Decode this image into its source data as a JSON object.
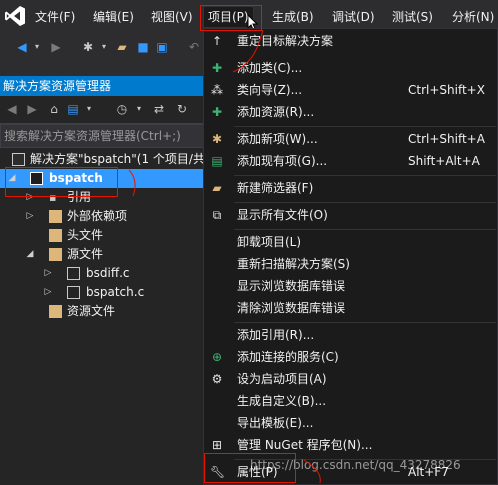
{
  "menubar": {
    "items": [
      "文件(F)",
      "编辑(E)",
      "视图(V)",
      "项目(P)",
      "生成(B)",
      "调试(D)",
      "测试(S)",
      "分析(N)"
    ]
  },
  "toolbar": {
    "icons": [
      "back-icon",
      "forward-icon",
      "new-project-icon",
      "open-icon",
      "save-icon",
      "save-all-icon",
      "undo-icon"
    ]
  },
  "solution_explorer": {
    "title": "解决方案资源管理器",
    "search_placeholder": "搜索解决方案资源管理器(Ctrl+;)",
    "tree": {
      "solution": "解决方案\"bspatch\"(1 个项目/共",
      "project": "bspatch",
      "references": "引用",
      "external_deps": "外部依赖项",
      "header_files": "头文件",
      "source_files": "源文件",
      "file1": "bsdiff.c",
      "file2": "bspatch.c",
      "resource_files": "资源文件"
    }
  },
  "project_menu": {
    "items": [
      {
        "label": "重定目标解决方案",
        "shortcut": ""
      },
      {
        "label": "添加类(C)...",
        "shortcut": ""
      },
      {
        "label": "类向导(Z)...",
        "shortcut": "Ctrl+Shift+X"
      },
      {
        "label": "添加资源(R)...",
        "shortcut": ""
      },
      {
        "label": "添加新项(W)...",
        "shortcut": "Ctrl+Shift+A"
      },
      {
        "label": "添加现有项(G)...",
        "shortcut": "Shift+Alt+A"
      },
      {
        "label": "新建筛选器(F)",
        "shortcut": ""
      },
      {
        "label": "显示所有文件(O)",
        "shortcut": ""
      },
      {
        "label": "卸载项目(L)",
        "shortcut": ""
      },
      {
        "label": "重新扫描解决方案(S)",
        "shortcut": ""
      },
      {
        "label": "显示浏览数据库错误",
        "shortcut": ""
      },
      {
        "label": "清除浏览数据库错误",
        "shortcut": ""
      },
      {
        "label": "添加引用(R)...",
        "shortcut": ""
      },
      {
        "label": "添加连接的服务(C)",
        "shortcut": ""
      },
      {
        "label": "设为启动项目(A)",
        "shortcut": ""
      },
      {
        "label": "生成自定义(B)...",
        "shortcut": ""
      },
      {
        "label": "导出模板(E)...",
        "shortcut": ""
      },
      {
        "label": "管理 NuGet 程序包(N)...",
        "shortcut": ""
      },
      {
        "label": "属性(P)",
        "shortcut": "Alt+F7"
      }
    ]
  },
  "watermark": "https://blog.csdn.net/qq_43278826",
  "colors": {
    "accent": "#007acc",
    "selection": "#3399ff",
    "annotation": "#e51400"
  }
}
